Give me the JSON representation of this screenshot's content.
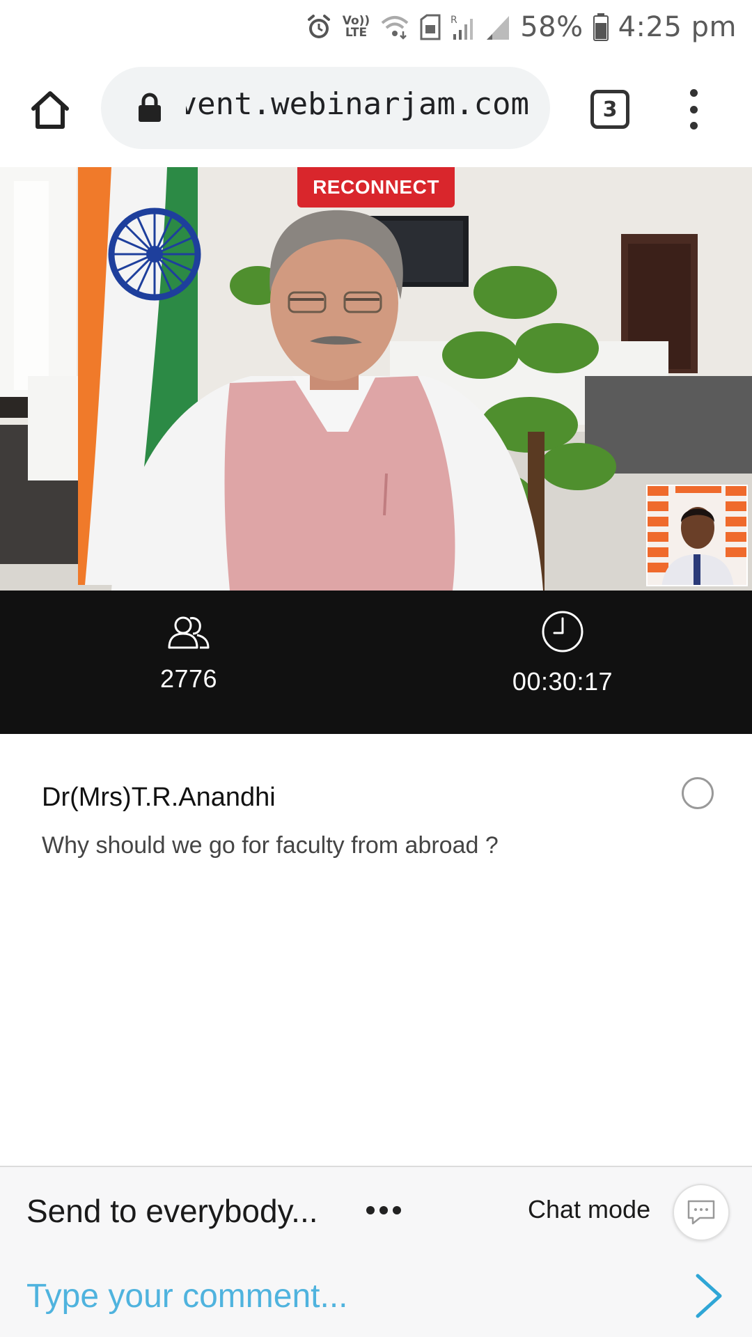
{
  "status_bar": {
    "volte_top": "Vo))",
    "volte_bottom": "LTE",
    "battery": "58%",
    "time": "4:25 pm",
    "icons": [
      "alarm-icon",
      "volte-icon",
      "wifi-icon",
      "sim-icon",
      "signal-r-icon",
      "signal-icon",
      "battery-icon"
    ]
  },
  "browser": {
    "url": "event.webinarjam.com",
    "tab_count": "3",
    "icons": [
      "home-icon",
      "lock-icon",
      "tabs-icon",
      "more-vert-icon"
    ]
  },
  "video": {
    "reconnect_label": "RECONNECT",
    "reconnect_color": "#d9262c"
  },
  "stats": {
    "attendees": "2776",
    "timer": "00:30:17",
    "icons": [
      "attendees-icon",
      "clock-icon"
    ]
  },
  "chat": {
    "messages": [
      {
        "author": "Dr(Mrs)T.R.Anandhi",
        "text": "Why should we go for faculty from abroad ?"
      }
    ]
  },
  "composer": {
    "send_to": "Send to everybody...",
    "chat_mode_label": "Chat mode",
    "comment_placeholder": "Type your comment...",
    "accent_color": "#2fa6d6",
    "icons": [
      "more-horiz-icon",
      "chat-bubble-icon",
      "send-chevron-icon"
    ]
  }
}
